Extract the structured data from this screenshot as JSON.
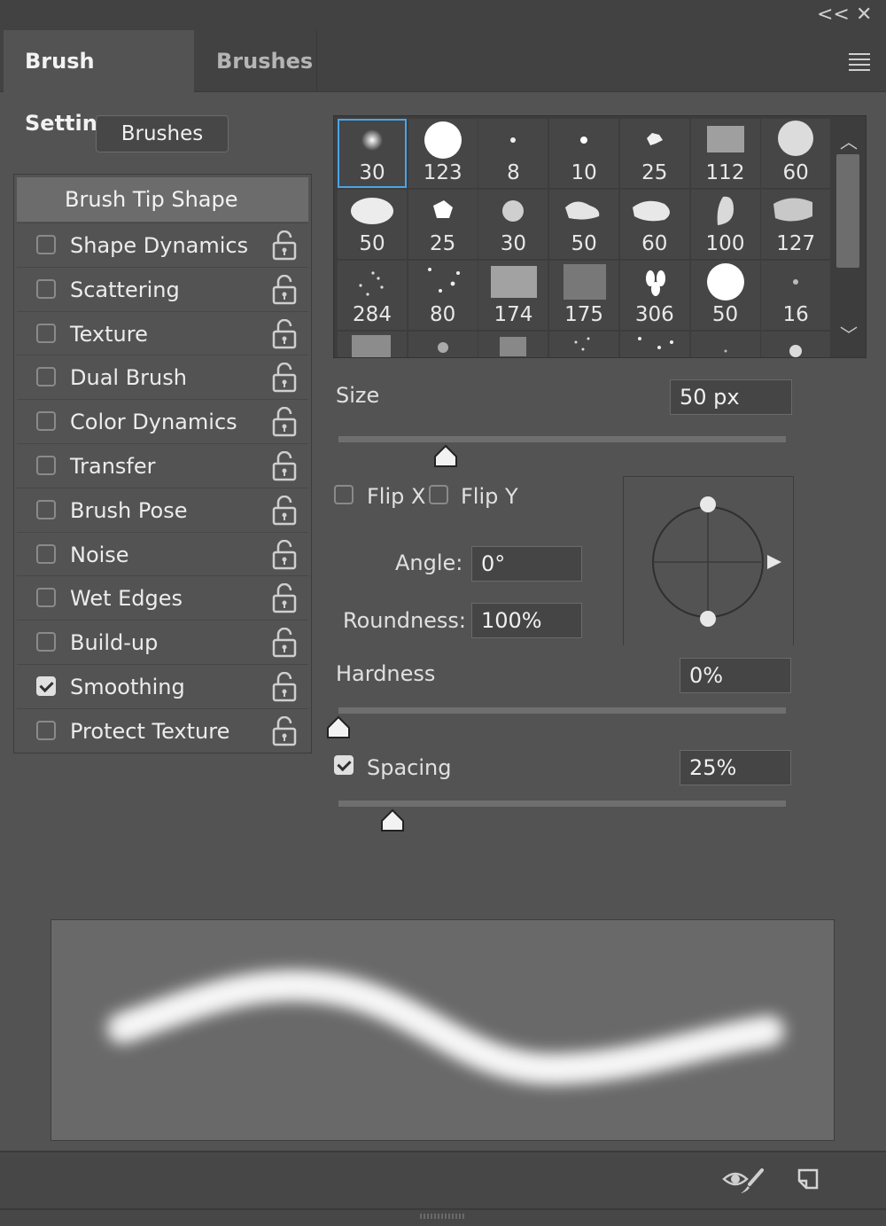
{
  "header": {
    "collapse_glyph": "<<",
    "close_glyph": "✕"
  },
  "tabs": [
    {
      "label": "Brush Settings",
      "active": true
    },
    {
      "label": "Brushes",
      "active": false
    }
  ],
  "brushes_button": "Brushes",
  "options": {
    "head": "Brush Tip Shape",
    "items": [
      {
        "label": "Shape Dynamics",
        "checked": false
      },
      {
        "label": "Scattering",
        "checked": false
      },
      {
        "label": "Texture",
        "checked": false
      },
      {
        "label": "Dual Brush",
        "checked": false
      },
      {
        "label": "Color Dynamics",
        "checked": false
      },
      {
        "label": "Transfer",
        "checked": false
      },
      {
        "label": "Brush Pose",
        "checked": false
      },
      {
        "label": "Noise",
        "checked": false
      },
      {
        "label": "Wet Edges",
        "checked": false
      },
      {
        "label": "Build-up",
        "checked": false
      },
      {
        "label": "Smoothing",
        "checked": true
      },
      {
        "label": "Protect Texture",
        "checked": false
      }
    ]
  },
  "presets": {
    "selected_index": 0,
    "rows": [
      [
        "30",
        "123",
        "8",
        "10",
        "25",
        "112",
        "60"
      ],
      [
        "50",
        "25",
        "30",
        "50",
        "60",
        "100",
        "127"
      ],
      [
        "284",
        "80",
        "174",
        "175",
        "306",
        "50",
        "16"
      ],
      [
        "",
        "",
        "",
        "",
        "",
        "",
        ""
      ]
    ]
  },
  "size": {
    "label": "Size",
    "value": "50 px",
    "slider_fraction": 0.24
  },
  "flip": {
    "x_label": "Flip X",
    "y_label": "Flip Y",
    "x_checked": false,
    "y_checked": false
  },
  "angle": {
    "label": "Angle:",
    "value": "0°"
  },
  "roundness": {
    "label": "Roundness:",
    "value": "100%"
  },
  "hardness": {
    "label": "Hardness",
    "value": "0%",
    "slider_fraction": 0.0
  },
  "spacing": {
    "label": "Spacing",
    "value": "25%",
    "checked": true,
    "slider_fraction": 0.12
  },
  "footer": {
    "icons": [
      "eye-brush-icon",
      "new-preset-icon"
    ]
  }
}
